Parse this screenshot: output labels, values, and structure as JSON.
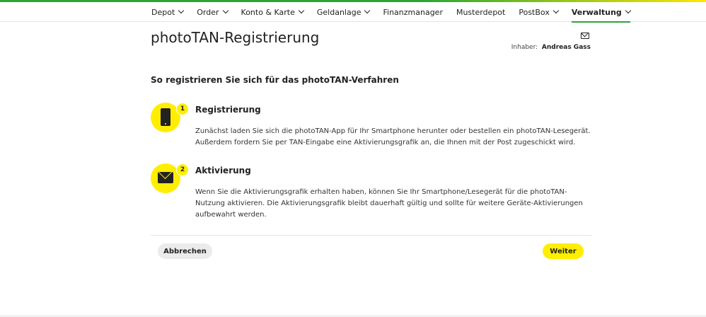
{
  "nav": {
    "items": [
      {
        "label": "Depot",
        "dropdown": true,
        "active": false
      },
      {
        "label": "Order",
        "dropdown": true,
        "active": false
      },
      {
        "label": "Konto & Karte",
        "dropdown": true,
        "active": false
      },
      {
        "label": "Geldanlage",
        "dropdown": true,
        "active": false
      },
      {
        "label": "Finanzmanager",
        "dropdown": false,
        "active": false
      },
      {
        "label": "Musterdepot",
        "dropdown": false,
        "active": false
      },
      {
        "label": "PostBox",
        "dropdown": true,
        "active": false
      },
      {
        "label": "Verwaltung",
        "dropdown": true,
        "active": true
      }
    ]
  },
  "header": {
    "title": "photoTAN-Registrierung",
    "owner_label": "Inhaber:",
    "owner_name": "Andreas Gass",
    "mail_icon": "envelope-icon"
  },
  "content": {
    "heading": "So registrieren Sie sich für das photoTAN-Verfahren",
    "steps": [
      {
        "number": "1",
        "icon": "smartphone-icon",
        "title": "Registrierung",
        "text": "Zunächst laden Sie sich die photoTAN-App für Ihr Smartphone herunter oder bestellen ein photoTAN-Lesegerät. Außerdem fordern Sie per TAN-Eingabe eine Aktivierungsgrafik an, die Ihnen mit der Post zugeschickt wird."
      },
      {
        "number": "2",
        "icon": "envelope-icon",
        "title": "Aktivierung",
        "text": "Wenn Sie die Aktivierungsgrafik erhalten haben, können Sie Ihr Smartphone/Lesegerät für die photoTAN-Nutzung aktivieren. Die Aktivierungsgrafik bleibt dauerhaft gültig und sollte für weitere Geräte-Aktivierungen aufbewahrt werden."
      }
    ]
  },
  "actions": {
    "cancel_label": "Abbrechen",
    "next_label": "Weiter"
  },
  "colors": {
    "accent_yellow": "#ffee00",
    "accent_green": "#2aa535"
  }
}
